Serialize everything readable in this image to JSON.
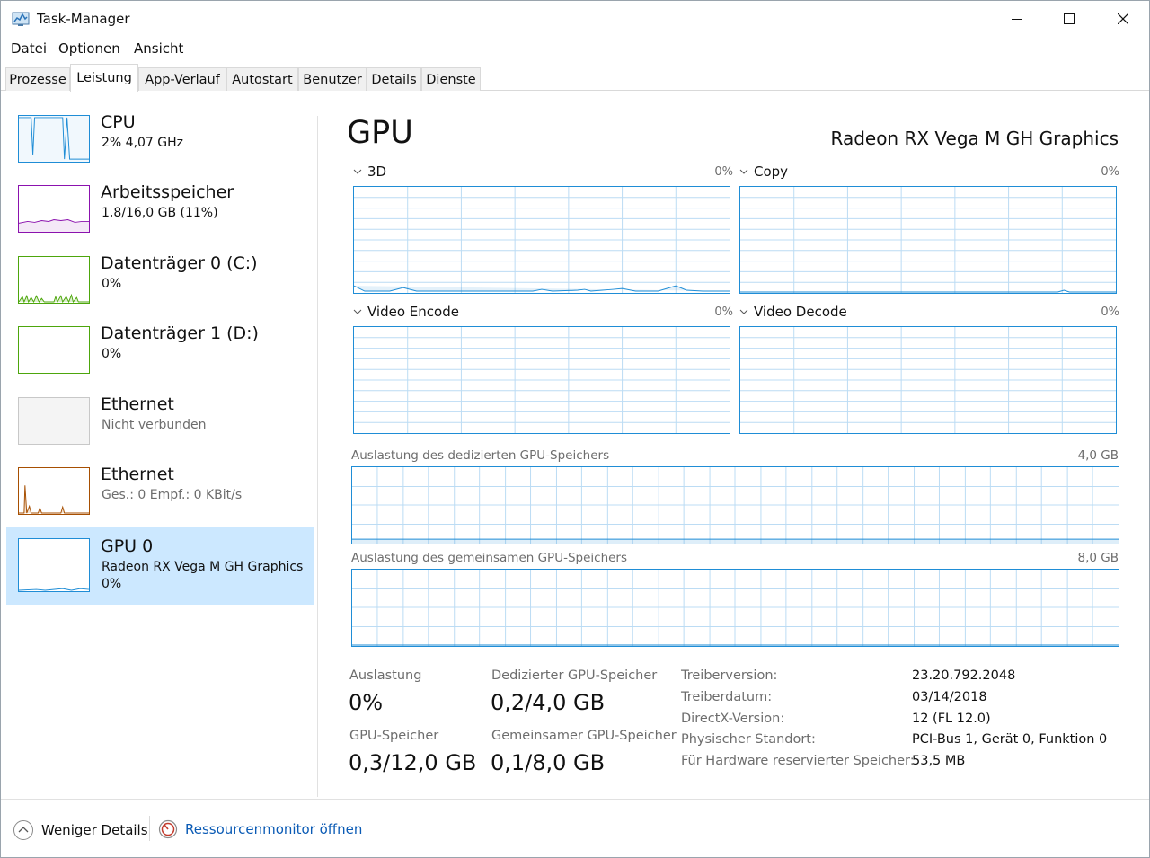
{
  "window": {
    "title": "Task-Manager"
  },
  "menu": [
    "Datei",
    "Optionen",
    "Ansicht"
  ],
  "tabs": [
    "Prozesse",
    "Leistung",
    "App-Verlauf",
    "Autostart",
    "Benutzer",
    "Details",
    "Dienste"
  ],
  "active_tab": "Leistung",
  "sidebar": {
    "items": [
      {
        "title": "CPU",
        "line1": "2% 4,07 GHz",
        "line2": "",
        "color": "#1f8dd6",
        "fill": "#f1f8fd",
        "selected": false
      },
      {
        "title": "Arbeitsspeicher",
        "line1": "1,8/16,0 GB (11%)",
        "line2": "",
        "color": "#8b12ae",
        "fill": "#f4e8f7",
        "selected": false
      },
      {
        "title": "Datenträger 0 (C:)",
        "line1": "0%",
        "line2": "",
        "color": "#4da60c",
        "fill": "#f0f8ea",
        "selected": false
      },
      {
        "title": "Datenträger 1 (D:)",
        "line1": "0%",
        "line2": "",
        "color": "#4da60c",
        "fill": "#ffffff",
        "selected": false
      },
      {
        "title": "Ethernet",
        "line1": "Nicht verbunden",
        "line2": "",
        "color": "#c8c8c8",
        "fill": "#f4f4f4",
        "selected": false
      },
      {
        "title": "Ethernet",
        "line1": "Ges.: 0 Empf.: 0 KBit/s",
        "line2": "",
        "color": "#a74f01",
        "fill": "#ffffff",
        "selected": false
      },
      {
        "title": "GPU 0",
        "line1": "Radeon RX Vega M GH Graphics",
        "line2": "0%",
        "color": "#1f8dd6",
        "fill": "#ffffff",
        "selected": true
      }
    ]
  },
  "main": {
    "title": "GPU",
    "model": "Radeon RX Vega M GH Graphics",
    "engines": [
      {
        "name": "3D",
        "pct": "0%"
      },
      {
        "name": "Copy",
        "pct": "0%"
      },
      {
        "name": "Video Encode",
        "pct": "0%"
      },
      {
        "name": "Video Decode",
        "pct": "0%"
      }
    ],
    "dedicated_label": "Auslastung des dedizierten GPU-Speichers",
    "dedicated_max": "4,0 GB",
    "shared_label": "Auslastung des gemeinsamen GPU-Speichers",
    "shared_max": "8,0 GB"
  },
  "stats": {
    "usage_label": "Auslastung",
    "usage_value": "0%",
    "dedicated_label": "Dedizierter GPU-Speicher",
    "dedicated_value": "0,2/4,0 GB",
    "gpu_mem_label": "GPU-Speicher",
    "gpu_mem_value": "0,3/12,0 GB",
    "shared_label": "Gemeinsamer GPU-Speicher",
    "shared_value": "0,1/8,0 GB"
  },
  "info": [
    {
      "label": "Treiberversion:",
      "value": "23.20.792.2048"
    },
    {
      "label": "Treiberdatum:",
      "value": "03/14/2018"
    },
    {
      "label": "DirectX-Version:",
      "value": "12 (FL 12.0)"
    },
    {
      "label": "Physischer Standort:",
      "value": "PCI-Bus 1, Gerät 0, Funktion 0"
    },
    {
      "label": "Für Hardware reservierter Speicher:",
      "value": "53,5 MB"
    }
  ],
  "footer": {
    "less_details": "Weniger Details",
    "resource_monitor": "Ressourcenmonitor öffnen"
  },
  "colors": {
    "accent": "#1f8dd6",
    "grid": "#bcdcf4",
    "selected_bg": "#cce8ff",
    "link": "#0b5bb5"
  }
}
